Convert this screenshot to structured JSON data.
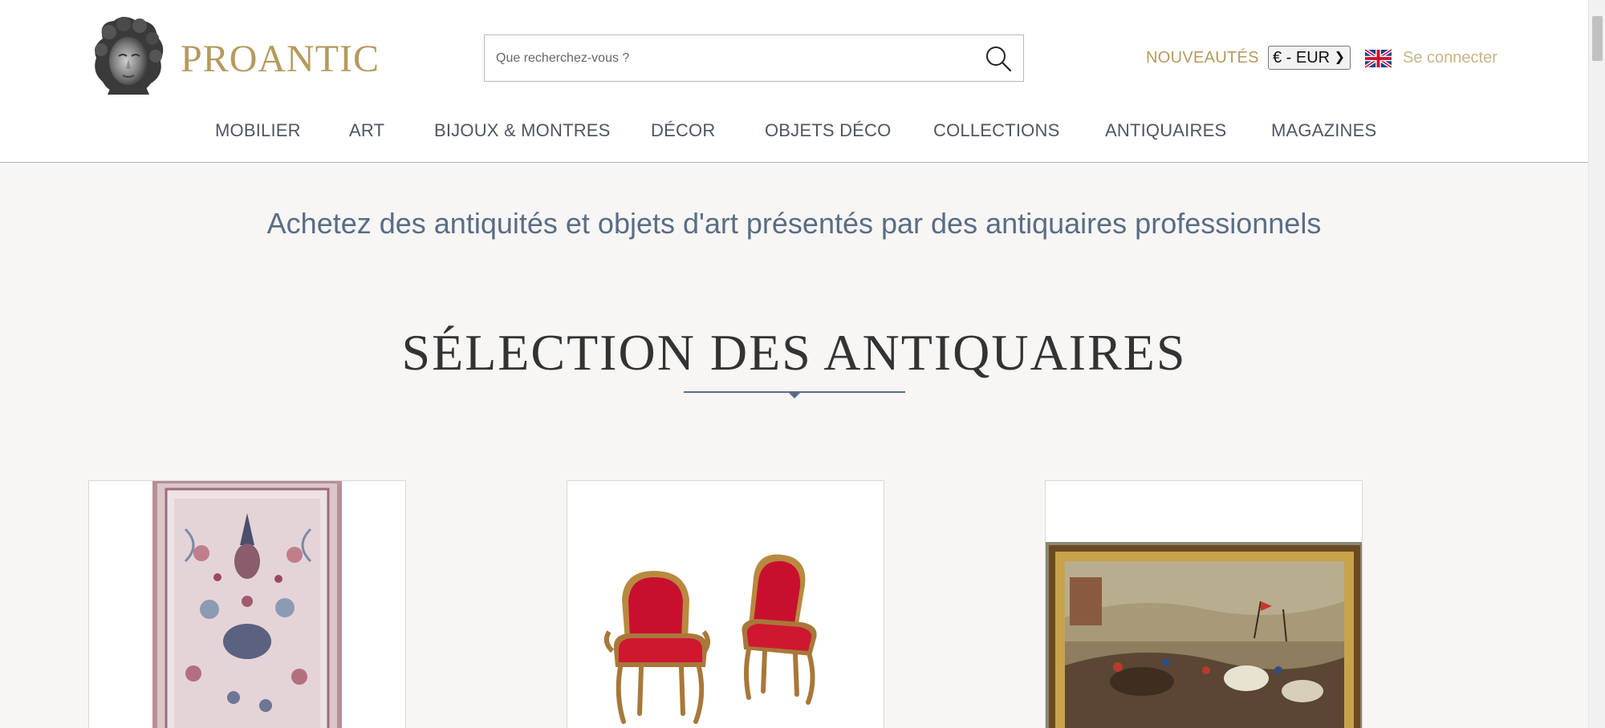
{
  "brand": {
    "name": "PROANTIC"
  },
  "search": {
    "placeholder": "Que recherchez-vous ?"
  },
  "header_links": {
    "news": "NOUVEAUTÉS",
    "currency": "€ - EUR",
    "login": "Se connecter"
  },
  "nav": {
    "items": [
      {
        "label": "MOBILIER"
      },
      {
        "label": "ART"
      },
      {
        "label": "BIJOUX & MONTRES"
      },
      {
        "label": "DÉCOR"
      },
      {
        "label": "OBJETS DÉCO"
      },
      {
        "label": "COLLECTIONS"
      },
      {
        "label": "ANTIQUAIRES"
      },
      {
        "label": "MAGAZINES"
      }
    ]
  },
  "main": {
    "tagline": "Achetez des antiquités et objets d'art présentés par des antiquaires professionnels",
    "section_title": "SÉLECTION DES ANTIQUAIRES"
  },
  "icons": {
    "logo": "classical-head-bust-icon",
    "search": "search-icon",
    "language": "uk-flag-icon"
  },
  "colors": {
    "brand_gold": "#b59a5d",
    "accent_blue": "#5a6d85",
    "nav_text": "#4e5662",
    "page_bg": "#f7f6f5"
  }
}
